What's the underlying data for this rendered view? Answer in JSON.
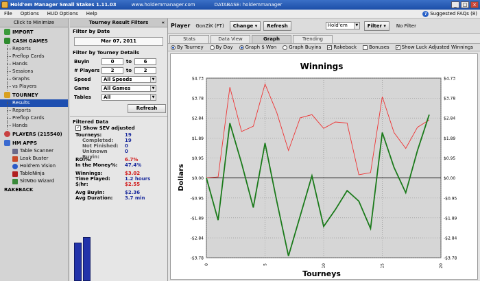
{
  "window": {
    "title": "Hold'em Manager Small Stakes 1.11.03",
    "site": "www.holdemmanager.com",
    "database": "DATABASE: holdemmanager"
  },
  "menu": {
    "items": [
      "File",
      "Options",
      "HUD Options",
      "Help"
    ],
    "faq_label": "Suggested FAQs (8)"
  },
  "sidebar": {
    "minimize_label": "Click to Minimize",
    "import_label": "IMPORT",
    "cash_label": "CASH GAMES",
    "cash_items": [
      "Reports",
      "Preflop Cards",
      "Hands",
      "Sessions",
      "Graphs",
      "vs Players"
    ],
    "tourney_label": "TOURNEY",
    "tourney_items": [
      "Results",
      "Reports",
      "Preflop Cards",
      "Hands"
    ],
    "players_label": "PLAYERS (215540)",
    "hmapps_label": "HM APPS",
    "app_items": [
      "Table Scanner",
      "Leak Buster",
      "Hold'em Vision",
      "TableNinja",
      "SitNGo Wizard"
    ],
    "rakeback_label": "RAKEBACK"
  },
  "filters": {
    "title": "Tourney Result Filters",
    "by_date_label": "Filter by Date",
    "date_value": "Mar 07, 2011",
    "details_label": "Filter by Tourney Details",
    "buyin_label": "Buyin",
    "buyin_from": "0",
    "buyin_to": "6",
    "players_label": "# Players",
    "players_from": "2",
    "players_to": "2",
    "to_label": "to",
    "speed_label": "Speed",
    "speed_value": "All Speeds",
    "game_label": "Game",
    "game_value": "All Games",
    "tables_label": "Tables",
    "tables_value": "All",
    "refresh_label": "Refresh",
    "filtered_label": "Filtered Data",
    "show_ev_label": "Show $EV adjusted",
    "stats": {
      "tourneys_label": "Tourneys:",
      "tourneys": "19",
      "completed_label": "Completed:",
      "completed": "19",
      "not_finished_label": "Not Finished:",
      "not_finished": "0",
      "unknown_buyin_label": "Unknown Buyin:",
      "unknown_buyin": "0",
      "roi_label": "ROI%:",
      "roi": "6.7%",
      "itm_label": "In the Money%:",
      "itm": "47.4%",
      "winnings_label": "Winnings:",
      "winnings": "$3.02",
      "time_label": "Time Played:",
      "time": "1.2 hours",
      "per_hour_label": "$/hr:",
      "per_hour": "$2.55",
      "avg_buyin_label": "Avg Buyin:",
      "avg_buyin": "$2.36",
      "avg_duration_label": "Avg Duration:",
      "avg_duration": "3.7 min"
    }
  },
  "main": {
    "player_label": "Player",
    "player_name": "GonZiK (FT)",
    "change_label": "Change",
    "refresh_label": "Refresh",
    "game_type": "Hold'em",
    "filter_label": "Filter",
    "no_filter_label": "No Filter",
    "tabs": [
      "Stats",
      "Data View",
      "Graph",
      "Trending"
    ],
    "active_tab": "Graph",
    "options": {
      "by_tourney": "By Tourney",
      "by_day": "By Day",
      "graph_won": "Graph $ Won",
      "graph_buyins": "Graph Buyins",
      "rakeback": "Rakeback",
      "bonuses": "Bonuses",
      "show_luck": "Show Luck Adjusted Winnings"
    }
  },
  "colors": {
    "winnings_line": "#1a7a1a",
    "ev_line": "#ee3333",
    "bars": "#2233aa",
    "selection": "#1e4fb0"
  },
  "chart_data": {
    "type": "line",
    "title": "Winnings",
    "xlabel": "Tourneys",
    "ylabel": "Dollars",
    "xlim": [
      0,
      20
    ],
    "ylim": [
      -3.78,
      4.73
    ],
    "x_ticks": [
      0,
      5,
      10,
      15,
      20
    ],
    "y_ticks": [
      "$4.73",
      "$3.78",
      "$2.84",
      "$1.89",
      "$0.95",
      "$0.00",
      "-$0.95",
      "-$1.89",
      "-$2.84",
      "-$3.78"
    ],
    "y_tick_values": [
      4.73,
      3.78,
      2.84,
      1.89,
      0.95,
      0.0,
      -0.95,
      -1.89,
      -2.84,
      -3.78
    ],
    "grid": true,
    "series": [
      {
        "color": "#ee3333",
        "x": [
          0,
          1,
          2,
          3,
          4,
          5,
          6,
          7,
          8,
          9,
          10,
          11,
          12,
          13,
          14,
          15,
          16,
          17,
          18,
          19
        ],
        "values": [
          0.0,
          0.05,
          4.3,
          2.2,
          2.45,
          4.45,
          3.1,
          1.3,
          2.85,
          3.0,
          2.35,
          2.65,
          2.6,
          0.15,
          0.25,
          3.85,
          2.15,
          1.4,
          2.4,
          2.75
        ]
      },
      {
        "color": "#1a7a1a",
        "x": [
          0,
          1,
          2,
          3,
          4,
          5,
          6,
          7,
          8,
          9,
          10,
          11,
          12,
          13,
          14,
          15,
          16,
          17,
          18,
          19
        ],
        "values": [
          0.0,
          -2.0,
          2.6,
          0.7,
          -1.4,
          1.65,
          -1.1,
          -3.7,
          -1.8,
          0.1,
          -2.3,
          -1.5,
          -0.6,
          -1.1,
          -2.4,
          2.15,
          0.5,
          -0.7,
          1.3,
          3.0
        ]
      }
    ]
  }
}
